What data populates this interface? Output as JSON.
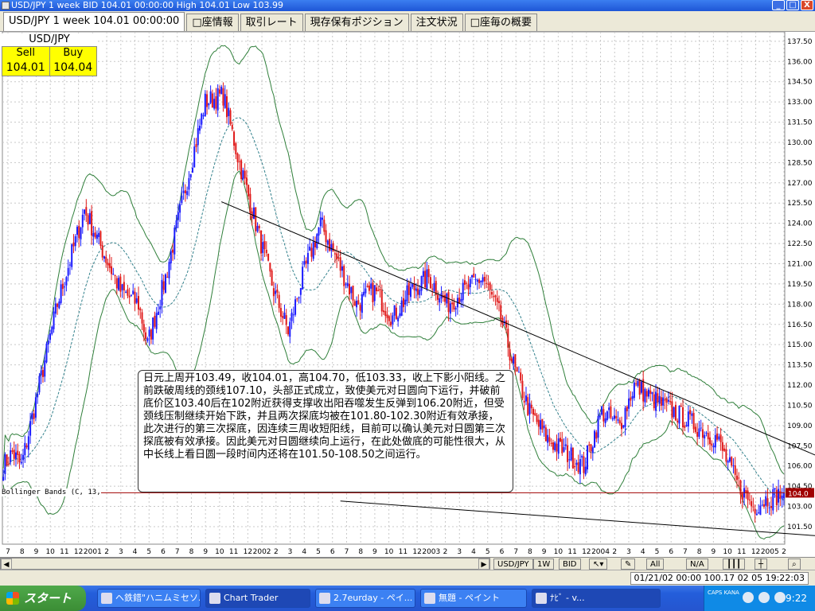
{
  "window": {
    "title": "USD/JPY 1 week BID 104.01 00:00:00 High 104.01 Low 103.99",
    "buttons": [
      "_",
      "□",
      "X"
    ]
  },
  "tabs": [
    {
      "label": "USD/JPY 1 week 104.01 00:00:00"
    },
    {
      "label": "□座情報"
    },
    {
      "label": "取引レート"
    },
    {
      "label": "現存保有ポジション"
    },
    {
      "label": "注文状況"
    },
    {
      "label": "□座毎の概要"
    }
  ],
  "price_box": {
    "pair": "USD/JPY",
    "sell_label": "Sell",
    "buy_label": "Buy",
    "sell_value": "104.01",
    "buy_value": "104.04"
  },
  "indicator_label": "Bollinger Bands (C, 13,",
  "current_price_label": "104.0",
  "comment": "日元上周开103.49，收104.01，高104.70，低103.33，收上下影小阳线。之前跌破周线的颈线107.10，头部正式成立，致使美元对日圆向下运行，并破前底价区103.40后在102附近获得支撑收出阳吞噬发生反弹到106.20附近，但受颈线压制继续开始下跌，并且两次探底均被在101.80-102.30附近有效承接，此次进行的第三次探底，因连续三周收短阳线，目前可以确认美元对日圆第三次探底被有效承接。因此美元对日圆继续向上运行，在此处做底的可能性很大，从中长线上看日圆一段时间内还将在101.50-108.50之间运行。",
  "chart_data": {
    "type": "candlestick",
    "symbol": "USD/JPY",
    "timeframe": "1 week",
    "ylim": [
      100.2,
      138.2
    ],
    "y_ticks": [
      "137.50",
      "136.00",
      "134.50",
      "133.00",
      "131.50",
      "130.00",
      "128.50",
      "127.00",
      "125.50",
      "124.00",
      "122.50",
      "121.00",
      "119.50",
      "118.00",
      "116.50",
      "115.00",
      "113.50",
      "112.00",
      "110.50",
      "109.00",
      "107.50",
      "106.00",
      "104.50",
      "103.00",
      "101.50"
    ],
    "x_ticks": [
      "7",
      "8",
      "9",
      "10",
      "11",
      "12",
      "2001",
      "2",
      "3",
      "4",
      "5",
      "6",
      "7",
      "8",
      "9",
      "10",
      "11",
      "12",
      "2002",
      "2",
      "3",
      "4",
      "5",
      "6",
      "7",
      "8",
      "9",
      "10",
      "11",
      "12",
      "2003",
      "2",
      "3",
      "4",
      "5",
      "6",
      "7",
      "8",
      "9",
      "10",
      "11",
      "12",
      "2004",
      "2",
      "3",
      "4",
      "5",
      "6",
      "7",
      "8",
      "9",
      "10",
      "11",
      "12",
      "2005",
      "2"
    ],
    "bollinger": {
      "period": 13
    },
    "anchors": [
      [
        0,
        106
      ],
      [
        5,
        107
      ],
      [
        10,
        106
      ],
      [
        20,
        112
      ],
      [
        30,
        118
      ],
      [
        45,
        125
      ],
      [
        55,
        122
      ],
      [
        65,
        119
      ],
      [
        75,
        118
      ],
      [
        80,
        115
      ],
      [
        90,
        120
      ],
      [
        100,
        126
      ],
      [
        112,
        133
      ],
      [
        122,
        133.5
      ],
      [
        130,
        129
      ],
      [
        140,
        124
      ],
      [
        150,
        119
      ],
      [
        158,
        116
      ],
      [
        166,
        120
      ],
      [
        176,
        124
      ],
      [
        186,
        121
      ],
      [
        196,
        118
      ],
      [
        206,
        119
      ],
      [
        216,
        117
      ],
      [
        226,
        119
      ],
      [
        236,
        120
      ],
      [
        246,
        118
      ],
      [
        256,
        119
      ],
      [
        266,
        120
      ],
      [
        276,
        117
      ],
      [
        284,
        113
      ],
      [
        292,
        110
      ],
      [
        302,
        108
      ],
      [
        312,
        107
      ],
      [
        322,
        106
      ],
      [
        332,
        110
      ],
      [
        342,
        109
      ],
      [
        350,
        112
      ],
      [
        360,
        111
      ],
      [
        372,
        110
      ],
      [
        384,
        109
      ],
      [
        396,
        108
      ],
      [
        406,
        105
      ],
      [
        416,
        103
      ],
      [
        424,
        103.6
      ],
      [
        433,
        104.0
      ]
    ],
    "trendlines": [
      [
        [
          121,
          125.6
        ],
        [
          433,
          107.8
        ]
      ],
      [
        [
          187,
          103.4
        ],
        [
          433,
          101.0
        ]
      ]
    ],
    "colors": {
      "up": "#1a1aff",
      "down": "#e01a1a",
      "band": "#2f7f3a",
      "mid": "#2f7f8a",
      "grid": "#c8c8c8",
      "price_line": "#a00000"
    }
  },
  "nav": {
    "symbol_btn": "USD/JPY",
    "tf_btn": "1W",
    "bid_btn": "BID",
    "all_btn": "All",
    "na_btn": "N/A"
  },
  "status": {
    "datetime": "01/21/02 00:00   100.17 02 05 19:22:03"
  },
  "taskbar": {
    "start_label": "スタート",
    "tasks": [
      "ヘ鉄錯\"ハニムミセソハ...",
      "Chart Trader",
      "2.7eurday - ペイ...",
      "無題 - ペイント",
      "ﾅﾋﾞ - v..."
    ],
    "tray_caps": "CAPS KANA",
    "clock": "9:22"
  }
}
